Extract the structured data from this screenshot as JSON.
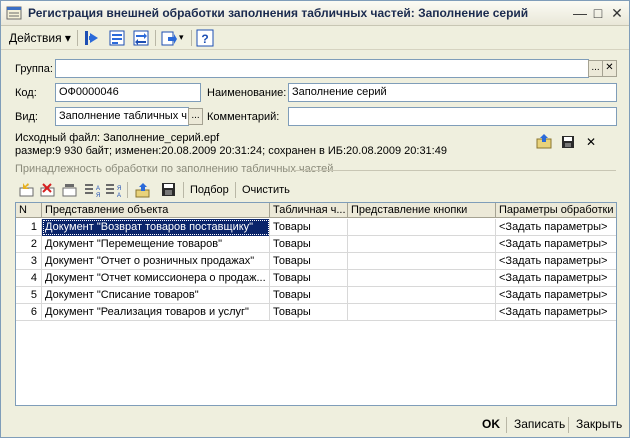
{
  "window": {
    "title": "Регистрация внешней обработки заполнения табличных частей: Заполнение серий",
    "controls": [
      "minimize",
      "maximize",
      "close"
    ]
  },
  "toolbar": {
    "actions_label": "Действия",
    "icons": [
      "arrow-left-icon",
      "form-icon",
      "arrows-icon",
      "transfer-icon",
      "help-icon"
    ]
  },
  "form": {
    "group_label": "Группа:",
    "group_value": "",
    "code_label": "Код:",
    "code_value": "ОФ0000046",
    "name_label": "Наименование:",
    "name_value": "Заполнение серий",
    "kind_label": "Вид:",
    "kind_value": "Заполнение табличных ч",
    "comment_label": "Комментарий:",
    "comment_value": ""
  },
  "file": {
    "source_line": "Исходный файл: Заполнение_серий.epf",
    "size_line": "размер:9 930 байт; изменен:20.08.2009 20:31:24; сохранен в ИБ:20.08.2009 20:31:49"
  },
  "section": {
    "title": "Принадлежность обработки по заполнению табличных частей"
  },
  "table_toolbar": {
    "select_label": "Подбор",
    "clear_label": "Очистить"
  },
  "table": {
    "headers": [
      "N",
      "Представление объекта",
      "Табличная ч...",
      "Представление кнопки",
      "Параметры обработки"
    ],
    "rows": [
      {
        "n": "1",
        "object": "Документ \"Возврат товаров поставщику\"",
        "part": "Товары",
        "button": "",
        "params": "<Задать параметры>"
      },
      {
        "n": "2",
        "object": "Документ \"Перемещение товаров\"",
        "part": "Товары",
        "button": "",
        "params": "<Задать параметры>"
      },
      {
        "n": "3",
        "object": "Документ \"Отчет о розничных продажах\"",
        "part": "Товары",
        "button": "",
        "params": "<Задать параметры>"
      },
      {
        "n": "4",
        "object": "Документ \"Отчет комиссионера о продаж...",
        "part": "Товары",
        "button": "",
        "params": "<Задать параметры>"
      },
      {
        "n": "5",
        "object": "Документ \"Списание товаров\"",
        "part": "Товары",
        "button": "",
        "params": "<Задать параметры>"
      },
      {
        "n": "6",
        "object": "Документ \"Реализация товаров и услуг\"",
        "part": "Товары",
        "button": "",
        "params": "<Задать параметры>"
      }
    ]
  },
  "footer": {
    "ok_label": "OK",
    "save_label": "Записать",
    "close_label": "Закрыть"
  },
  "colors": {
    "selection": "#0a246a",
    "window_bg": "#efefde",
    "border": "#7f9db9"
  }
}
